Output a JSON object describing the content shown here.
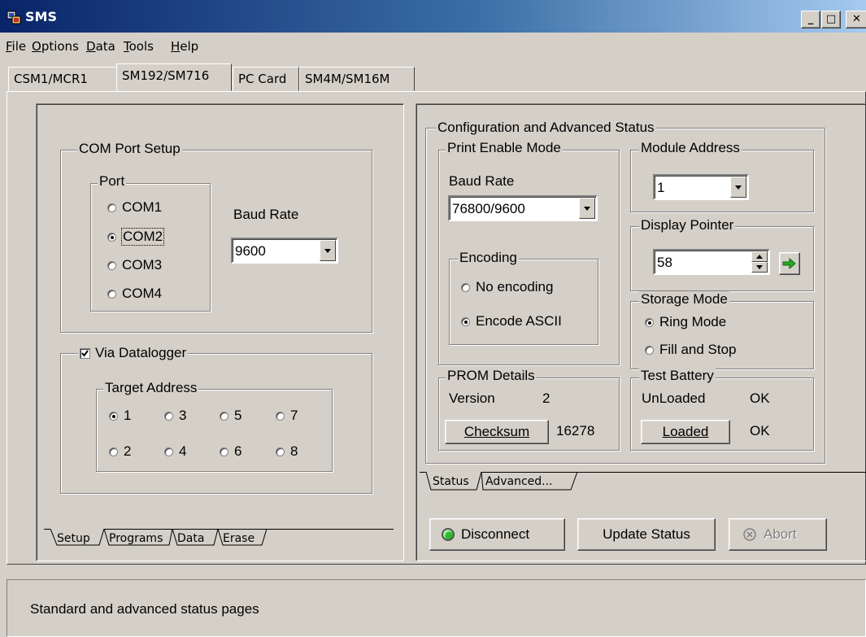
{
  "titlebar": {
    "title": "SMS",
    "min_label": "_",
    "max_label": "□",
    "close_label": "✕"
  },
  "menu": [
    {
      "hot": "F",
      "rest": "ile"
    },
    {
      "hot": "O",
      "rest": "ptions"
    },
    {
      "hot": "D",
      "rest": "ata"
    },
    {
      "hot": "T",
      "rest": "ools"
    },
    {
      "hot": "H",
      "rest": "elp"
    }
  ],
  "tabs": [
    "CSM1/MCR1",
    "SM192/SM716",
    "PC Card",
    "SM4M/SM16M"
  ],
  "left": {
    "com_setup": {
      "legend": "COM Port Setup",
      "port_legend": "Port",
      "ports": [
        "COM1",
        "COM2",
        "COM3",
        "COM4"
      ],
      "selected_port": "COM2",
      "baud_label": "Baud Rate",
      "baud_value": "9600"
    },
    "datalogger": {
      "label": "Via Datalogger",
      "checked": true,
      "target_legend": "Target Address",
      "addresses": [
        "1",
        "3",
        "5",
        "7",
        "2",
        "4",
        "6",
        "8"
      ],
      "selected": "1"
    },
    "subtabs": [
      "Setup",
      "Programs",
      "Data",
      "Erase"
    ]
  },
  "right": {
    "config_legend": "Configuration and Advanced Status",
    "print_enable": {
      "legend": "Print Enable Mode",
      "baud_label": "Baud Rate",
      "baud_value": "76800/9600",
      "encoding_legend": "Encoding",
      "options": [
        "No encoding",
        "Encode ASCII"
      ],
      "selected": "Encode ASCII"
    },
    "module_address": {
      "legend": "Module Address",
      "value": "1"
    },
    "display_pointer": {
      "legend": "Display Pointer",
      "value": "58"
    },
    "storage_mode": {
      "legend": "Storage Mode",
      "options": [
        "Ring Mode",
        "Fill and Stop"
      ],
      "selected": "Ring Mode"
    },
    "prom": {
      "legend": "PROM Details",
      "version_label": "Version",
      "version_value": "2",
      "checksum_button": "Checksum",
      "checksum_value": "16278"
    },
    "test_battery": {
      "legend": "Test Battery",
      "unloaded_label": "UnLoaded",
      "unloaded_value": "OK",
      "loaded_button": "Loaded",
      "loaded_value": "OK"
    },
    "subtabs": [
      "Status",
      "Advanced..."
    ],
    "buttons": {
      "disconnect": "Disconnect",
      "update": "Update Status",
      "abort": "Abort"
    }
  },
  "statusbar": {
    "text": "Standard and advanced status pages"
  },
  "colors": {
    "face": "#d4d0c8",
    "title_start": "#0a246a",
    "title_end": "#a6caf0",
    "led_green": "#2fb52f",
    "arrow_green": "#22aa22"
  }
}
